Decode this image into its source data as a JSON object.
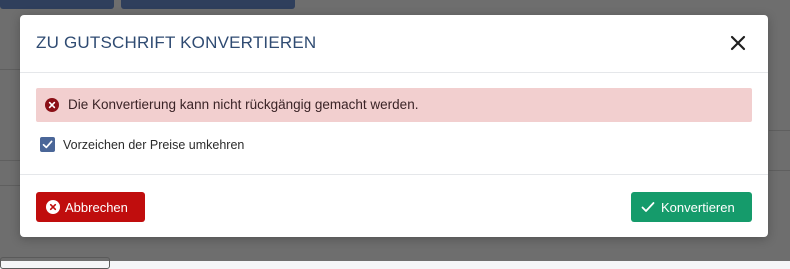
{
  "dialog": {
    "title": "ZU GUTSCHRIFT KONVERTIEREN",
    "close_icon": "close-icon",
    "alert": {
      "icon": "error-circle-icon",
      "text": "Die Konvertierung kann nicht rückgängig gemacht werden.",
      "background": "#f2cfcf"
    },
    "checkbox": {
      "label": "Vorzeichen der Preise umkehren",
      "checked": true,
      "color": "#4a6698"
    },
    "footer": {
      "cancel_label": "Abbrechen",
      "cancel_icon": "cancel-circle-icon",
      "cancel_color": "#c00d0d",
      "convert_label": "Konvertieren",
      "convert_icon": "check-icon",
      "convert_color": "#159b6b"
    }
  },
  "colors": {
    "title": "#2f4b72",
    "backdrop": "#6e6e6e"
  }
}
